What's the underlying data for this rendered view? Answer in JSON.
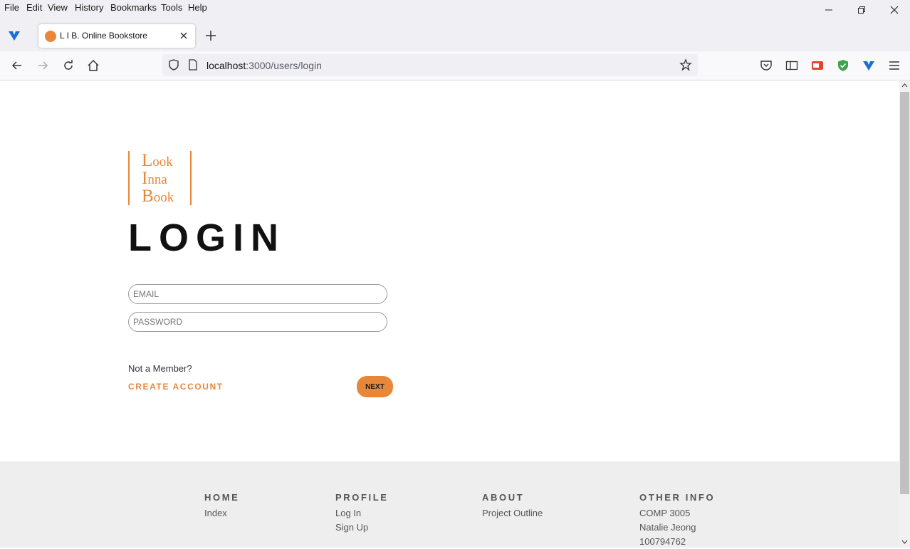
{
  "menu": [
    "File",
    "Edit",
    "View",
    "History",
    "Bookmarks",
    "Tools",
    "Help"
  ],
  "tab": {
    "title": "L I B. Online Bookstore"
  },
  "url": {
    "host": "localhost",
    "rest": ":3000/users/login"
  },
  "logo": {
    "lines": [
      {
        "initial": "L",
        "rest": "ook"
      },
      {
        "initial": "I",
        "rest": "nna"
      },
      {
        "initial": "B",
        "rest": "ook"
      }
    ]
  },
  "login": {
    "heading": "LOGIN",
    "email_placeholder": "EMAIL",
    "password_placeholder": "PASSWORD",
    "not_member": "Not a Member?",
    "create_account": "CREATE ACCOUNT",
    "next": "NEXT"
  },
  "footer": {
    "columns": [
      {
        "heading": "HOME",
        "items": [
          "Index"
        ]
      },
      {
        "heading": "PROFILE",
        "items": [
          "Log In",
          "Sign Up"
        ]
      },
      {
        "heading": "ABOUT",
        "items": [
          "Project Outline"
        ]
      },
      {
        "heading": "OTHER INFO",
        "items": [
          "COMP 3005",
          "Natalie Jeong",
          "100794762"
        ]
      }
    ]
  },
  "colors": {
    "accent": "#e8873a",
    "footer_bg": "#eeeeee"
  }
}
